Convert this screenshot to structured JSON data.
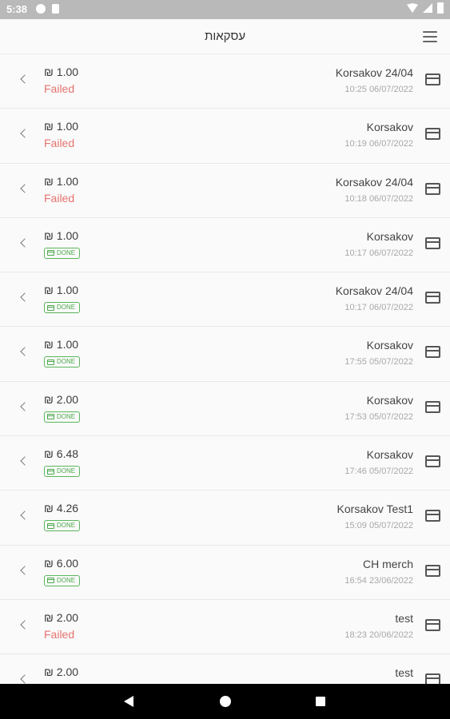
{
  "status_bar": {
    "time": "5:38"
  },
  "app_bar": {
    "title": "עסקאות",
    "menu_icon": "hamburger-menu-icon"
  },
  "colors": {
    "failed": "#e5736f",
    "done": "#4aa84a"
  },
  "done_label": "DONE",
  "transactions": [
    {
      "amount": "₪ 1.00",
      "status": "Failed",
      "merchant": "Korsakov 24/04",
      "datetime": "10:25 06/07/2022"
    },
    {
      "amount": "₪ 1.00",
      "status": "Failed",
      "merchant": "Korsakov",
      "datetime": "10:19 06/07/2022"
    },
    {
      "amount": "₪ 1.00",
      "status": "Failed",
      "merchant": "Korsakov 24/04",
      "datetime": "10:18 06/07/2022"
    },
    {
      "amount": "₪ 1.00",
      "status": "DONE",
      "merchant": "Korsakov",
      "datetime": "10:17 06/07/2022"
    },
    {
      "amount": "₪ 1.00",
      "status": "DONE",
      "merchant": "Korsakov 24/04",
      "datetime": "10:17 06/07/2022"
    },
    {
      "amount": "₪ 1.00",
      "status": "DONE",
      "merchant": "Korsakov",
      "datetime": "17:55 05/07/2022"
    },
    {
      "amount": "₪ 2.00",
      "status": "DONE",
      "merchant": "Korsakov",
      "datetime": "17:53 05/07/2022"
    },
    {
      "amount": "₪ 6.48",
      "status": "DONE",
      "merchant": "Korsakov",
      "datetime": "17:46 05/07/2022"
    },
    {
      "amount": "₪ 4.26",
      "status": "DONE",
      "merchant": "Korsakov Test1",
      "datetime": "15:09 05/07/2022"
    },
    {
      "amount": "₪ 6.00",
      "status": "DONE",
      "merchant": "CH merch",
      "datetime": "16:54 23/06/2022"
    },
    {
      "amount": "₪ 2.00",
      "status": "Failed",
      "merchant": "test",
      "datetime": "18:23 20/06/2022"
    },
    {
      "amount": "₪ 2.00",
      "status": "",
      "merchant": "test",
      "datetime": ""
    }
  ]
}
